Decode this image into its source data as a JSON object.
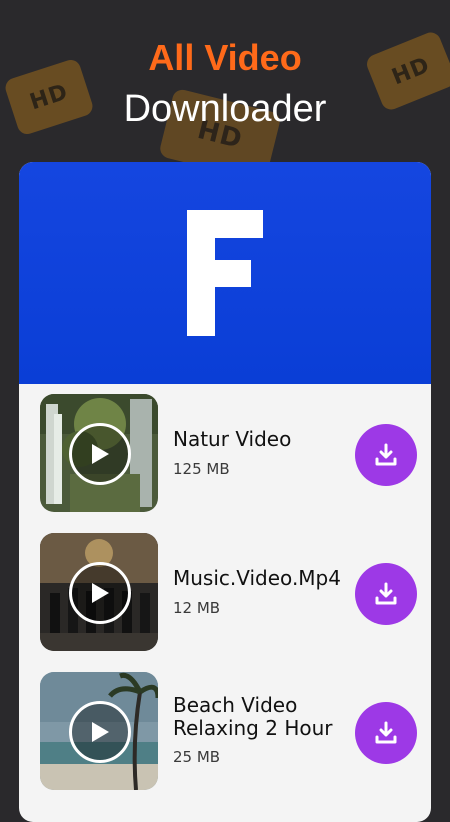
{
  "header": {
    "title_line1": "All Video",
    "title_line2": "Downloader",
    "badge_text": "HD"
  },
  "hero": {
    "logo": "facebook-f-logo"
  },
  "videos": [
    {
      "title": "Natur Video",
      "size": "125 MB",
      "thumb": "waterfall-forest"
    },
    {
      "title": "Music.Video.Mp4",
      "size": "12 MB",
      "thumb": "dancers-stage"
    },
    {
      "title": "Beach Video Relaxing 2 Hour",
      "size": "25 MB",
      "thumb": "palm-beach"
    }
  ],
  "colors": {
    "accent": "#ff6a1a",
    "hero_blue": "#0a3ed6",
    "download_purple": "#9d39e6",
    "background": "#2a292c"
  },
  "icons": {
    "play": "play-icon",
    "download": "download-icon"
  }
}
